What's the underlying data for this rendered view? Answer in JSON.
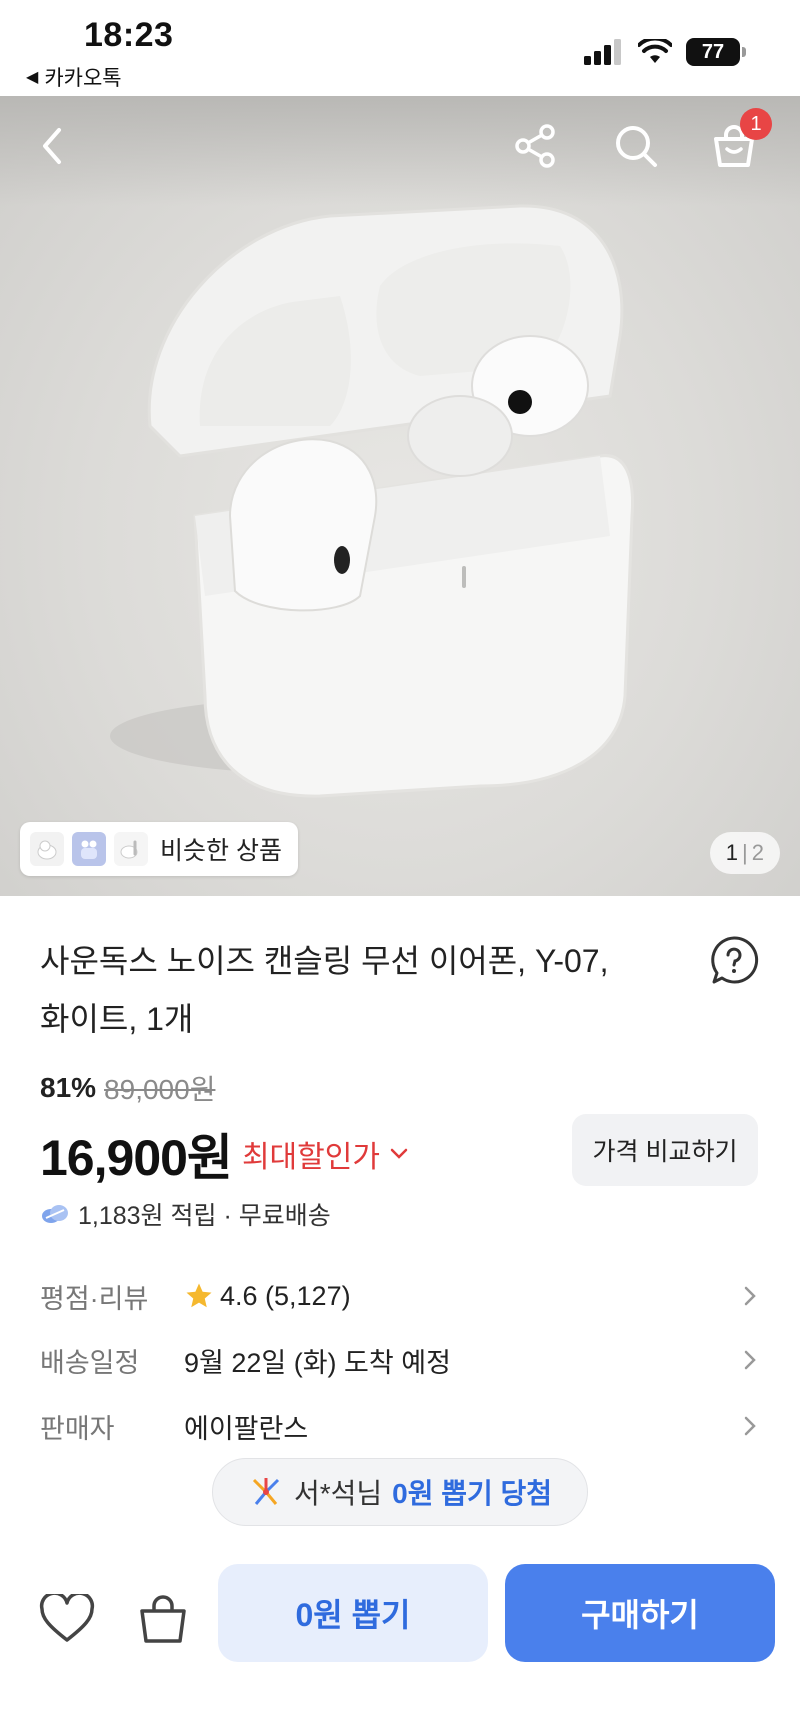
{
  "status_bar": {
    "time": "18:23",
    "back_app": "카카오톡",
    "battery": "77"
  },
  "hero": {
    "cart_count": "1",
    "similar_label": "비슷한 상품",
    "page_current": "1",
    "page_separator": "|",
    "page_total": "2"
  },
  "product": {
    "title_line1": "사운독스 노이즈 캔슬링 무선 이어폰, Y-07,",
    "title_line2": "화이트, 1개",
    "discount_percent": "81%",
    "original_price": "89,000원",
    "price": "16,900원",
    "max_discount_label": "최대할인가",
    "compare_button": "가격 비교하기",
    "points": "1,183원 적립 · 무료배송"
  },
  "info_rows": [
    {
      "key": "평점·리뷰",
      "value": "4.6 (5,127)"
    },
    {
      "key": "배송일정",
      "value": "9월 22일 (화) 도착 예정"
    },
    {
      "key": "판매자",
      "value": "에이팔란스"
    }
  ],
  "winner": {
    "name": "서*석님",
    "highlight": "0원 뽑기 당첨"
  },
  "bottom_bar": {
    "draw_button": "0원 뽑기",
    "buy_button": "구매하기"
  },
  "colors": {
    "accent_blue": "#4a80ec",
    "sale_red": "#e03a3a",
    "badge_red": "#e84545"
  }
}
